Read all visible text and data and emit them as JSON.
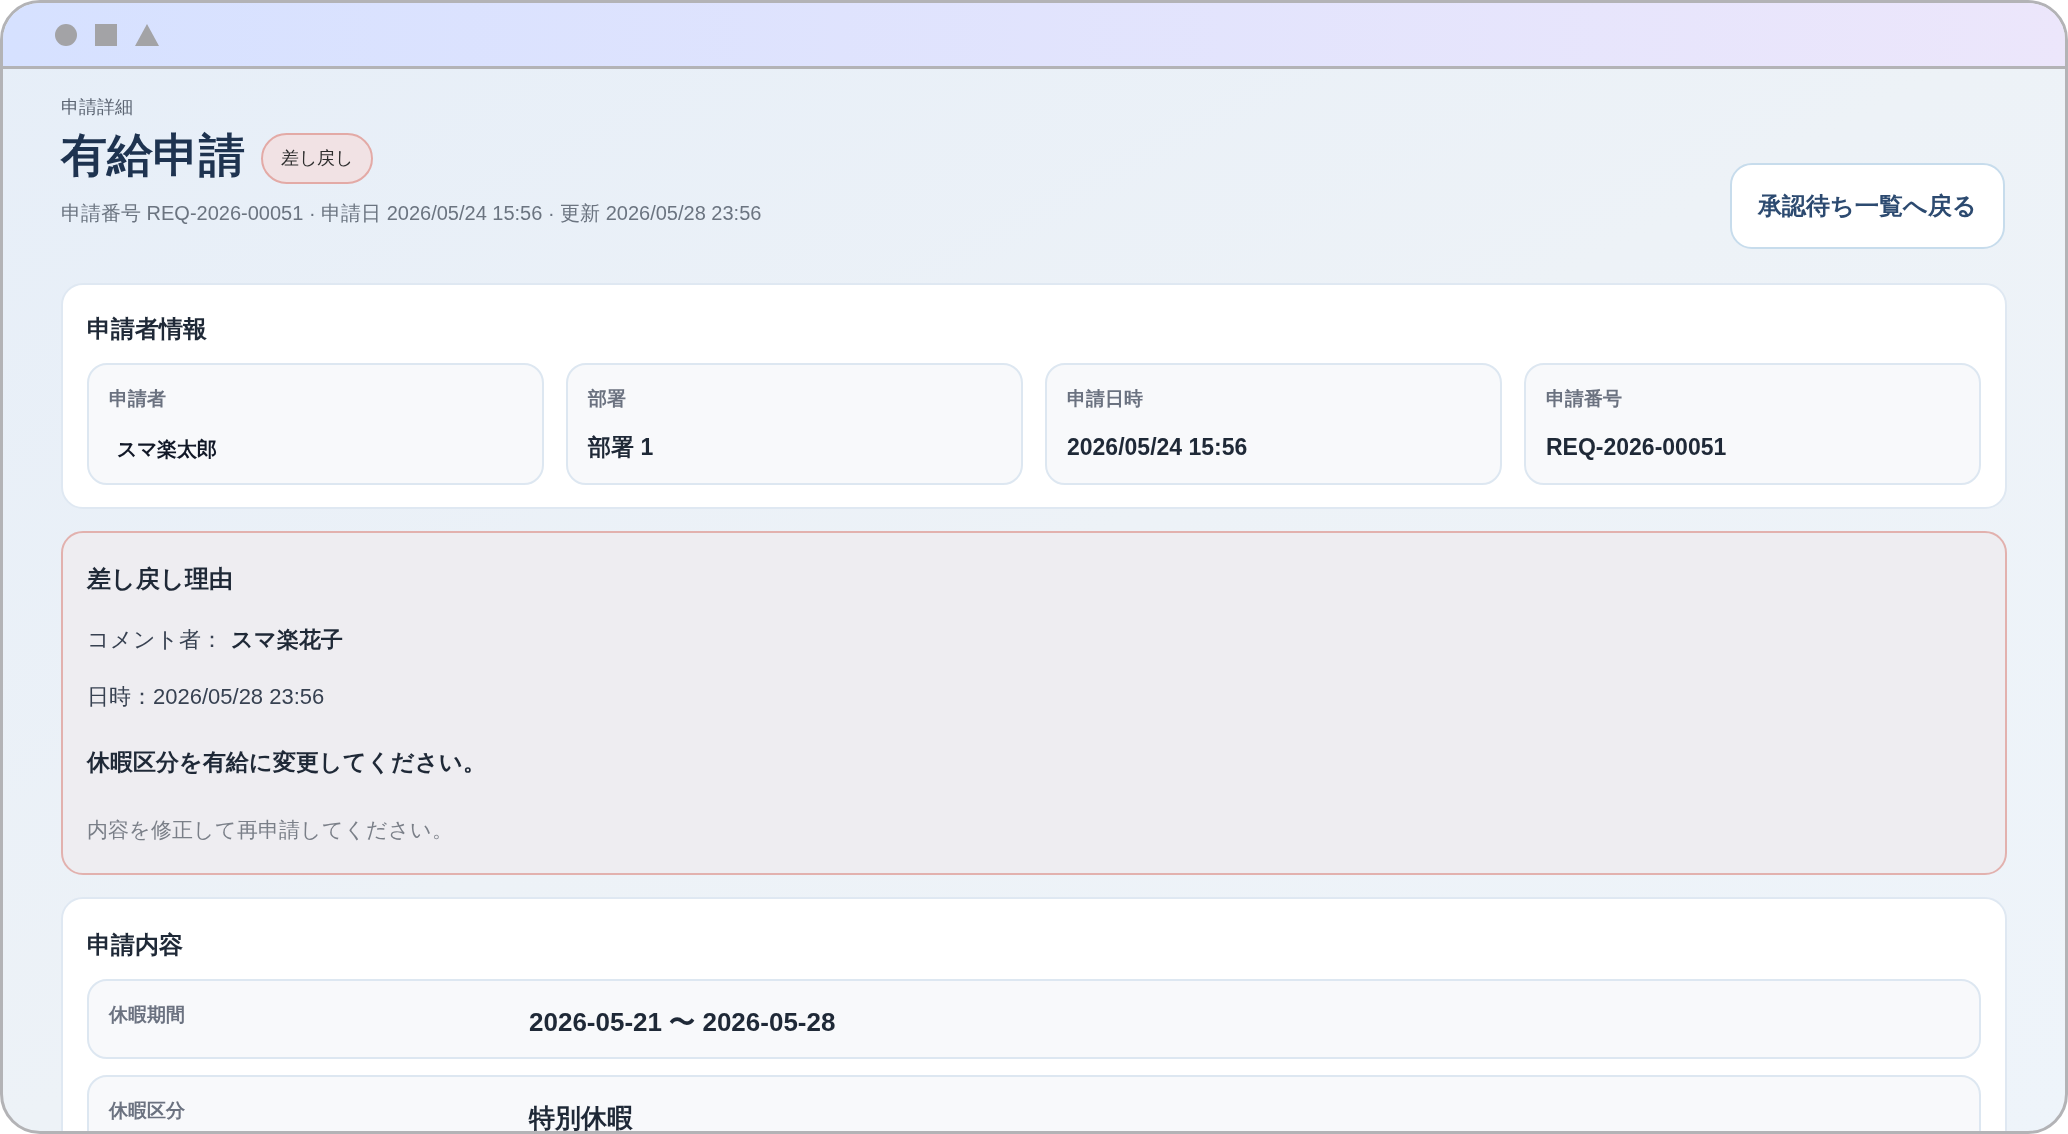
{
  "header": {
    "breadcrumb": "申請詳細",
    "title": "有給申請",
    "status_badge": "差し戻し",
    "meta": "申請番号 REQ-2026-00051 · 申請日 2026/05/24 15:56 · 更新 2026/05/28 23:56",
    "back_button": "承認待ち一覧へ戻る"
  },
  "applicant_info": {
    "title": "申請者情報",
    "fields": [
      {
        "label": "申請者",
        "value": "スマ楽太郎"
      },
      {
        "label": "部署",
        "value": "部署 1"
      },
      {
        "label": "申請日時",
        "value": "2026/05/24 15:56"
      },
      {
        "label": "申請番号",
        "value": "REQ-2026-00051"
      }
    ]
  },
  "return_reason": {
    "title": "差し戻し理由",
    "commenter_label": "コメント者：",
    "commenter": "スマ楽花子",
    "datetime": "日時：2026/05/28 23:56",
    "comment": "休暇区分を有給に変更してください。",
    "instruction": "内容を修正して再申請してください。"
  },
  "request_details": {
    "title": "申請内容",
    "rows": [
      {
        "label": "休暇期間",
        "value": "2026-05-21 〜 2026-05-28"
      },
      {
        "label": "休暇区分",
        "value": "特別休暇"
      }
    ]
  }
}
